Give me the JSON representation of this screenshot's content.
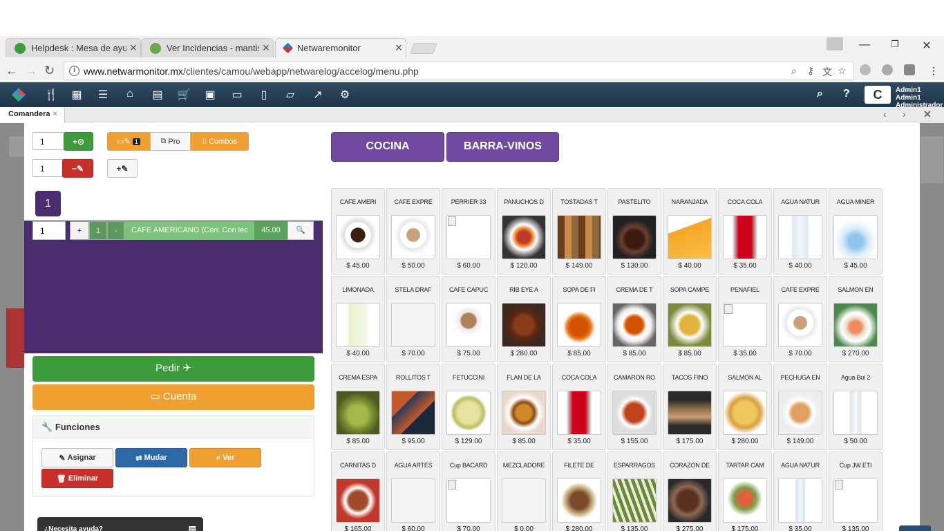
{
  "browser": {
    "tabs": [
      {
        "title": "Helpdesk : Mesa de ayud",
        "fav_color": "#3a9f3a"
      },
      {
        "title": "Ver Incidencias - mantis",
        "fav_color": "#6aa84f"
      },
      {
        "title": "Netwaremonitor",
        "fav_color": "#2d7ab8"
      }
    ],
    "url_domain": "www.netwarmonitor.mx",
    "url_path": "/clientes/camou/webapp/netwarelog/accelog/menu.php"
  },
  "app": {
    "user_name": "Admin1 Admin1",
    "user_role": "Administrador ▾",
    "active_tab": "Comandera",
    "close_tab": "×"
  },
  "left": {
    "qty_add": "1",
    "qty_remove": "1",
    "btn_pro": "Pro",
    "btn_combos": "Combos",
    "toggle_count": "1",
    "table_number": "1",
    "order_item": {
      "qty": "1",
      "plus": "+",
      "count": "1",
      "minus": "-",
      "name": "CAFE AMERICANO (Con: Con lec",
      "price": "45.00"
    },
    "pedir": "Pedir",
    "cuenta": "Cuenta",
    "funciones_title": "Funciones",
    "asignar": "Asignar",
    "mudar": "Mudar",
    "ver": "Ver",
    "eliminar": "Eliminar",
    "help_text": "¿Necesita ayuda?"
  },
  "categories": [
    "COCINA",
    "BARRA-VINOS"
  ],
  "products": [
    {
      "name": "CAFE AMERI",
      "price": "$ 45.00",
      "img": "coffee"
    },
    {
      "name": "CAFE EXPRE",
      "price": "$ 50.00",
      "img": "latte"
    },
    {
      "name": "PERRIER 33",
      "price": "$ 60.00",
      "img": "none"
    },
    {
      "name": "PANUCHOS D",
      "price": "$ 120.00",
      "img": "red-plate"
    },
    {
      "name": "TOSTADAS T",
      "price": "$ 149.00",
      "img": "tostada"
    },
    {
      "name": "PASTELITO",
      "price": "$ 130.00",
      "img": "cake"
    },
    {
      "name": "NARANJADA",
      "price": "$ 40.00",
      "img": "orange"
    },
    {
      "name": "COCA COLA",
      "price": "$ 35.00",
      "img": "can"
    },
    {
      "name": "AGUA NATUR",
      "price": "$ 40.00",
      "img": "water"
    },
    {
      "name": "AGUA MINER",
      "price": "$ 45.00",
      "img": "water2"
    },
    {
      "name": "LIMONADA",
      "price": "$ 40.00",
      "img": "lemonade"
    },
    {
      "name": "STELA DRAF",
      "price": "$ 70.00",
      "img": "blank"
    },
    {
      "name": "CAFE CAPUC",
      "price": "$ 75.00",
      "img": "cappu"
    },
    {
      "name": "RIB EYE A",
      "price": "$ 280.00",
      "img": "steak"
    },
    {
      "name": "SOPA DE FI",
      "price": "$ 85.00",
      "img": "pasta"
    },
    {
      "name": "CREMA DE T",
      "price": "$ 85.00",
      "img": "soup"
    },
    {
      "name": "SOPA CAMPE",
      "price": "$ 85.00",
      "img": "soup2"
    },
    {
      "name": "PENAFIEL",
      "price": "$ 35.00",
      "img": "none"
    },
    {
      "name": "CAFE EXPRE",
      "price": "$ 70.00",
      "img": "latte"
    },
    {
      "name": "SALMON EN",
      "price": "$ 270.00",
      "img": "salmon"
    },
    {
      "name": "CREMA ESPA",
      "price": "$ 85.00",
      "img": "greensoup"
    },
    {
      "name": "ROLLITOS T",
      "price": "$ 95.00",
      "img": "rolls"
    },
    {
      "name": "FETUCCINI",
      "price": "$ 129.00",
      "img": "fettuccine"
    },
    {
      "name": "FLAN DE LA",
      "price": "$ 85.00",
      "img": "flan"
    },
    {
      "name": "COCA COLA",
      "price": "$ 35.00",
      "img": "can"
    },
    {
      "name": "CAMARON RO",
      "price": "$ 155.00",
      "img": "shrimp"
    },
    {
      "name": "TACOS FINO",
      "price": "$ 175.00",
      "img": "tacos"
    },
    {
      "name": "SALMON AL",
      "price": "$ 280.00",
      "img": "gratin"
    },
    {
      "name": "PECHUGA EN",
      "price": "$ 149.00",
      "img": "chicken"
    },
    {
      "name": "Agua Bui 2",
      "price": "$ 50.00",
      "img": "bottle"
    },
    {
      "name": "CARNITAS D",
      "price": "$ 165.00",
      "img": "carnitas"
    },
    {
      "name": "AGUA ARTES",
      "price": "$ 60.00",
      "img": "blank"
    },
    {
      "name": "Cup BACARD",
      "price": "$ 70.00",
      "img": "none"
    },
    {
      "name": "MEZCLADORE",
      "price": "$ 0.00",
      "img": "blank"
    },
    {
      "name": "FILETE DE",
      "price": "$ 280.00",
      "img": "filete"
    },
    {
      "name": "ESPARRAGOS",
      "price": "$ 135.00",
      "img": "asparagus"
    },
    {
      "name": "CORAZON DE",
      "price": "$ 275.00",
      "img": "meat"
    },
    {
      "name": "TARTAR CAM",
      "price": "$ 175.00",
      "img": "tartar"
    },
    {
      "name": "AGUA NATUR",
      "price": "$ 35.00",
      "img": "bottle2"
    },
    {
      "name": "Cup JW ETI",
      "price": "$ 135.00",
      "img": "none"
    }
  ],
  "colors": {
    "purple": "#4a2d6e",
    "category": "#7049a1",
    "green": "#3c9c3c",
    "orange": "#f0a030",
    "red": "#c9302c",
    "blue": "#2b69a7",
    "appbar": "#2f4b62"
  }
}
